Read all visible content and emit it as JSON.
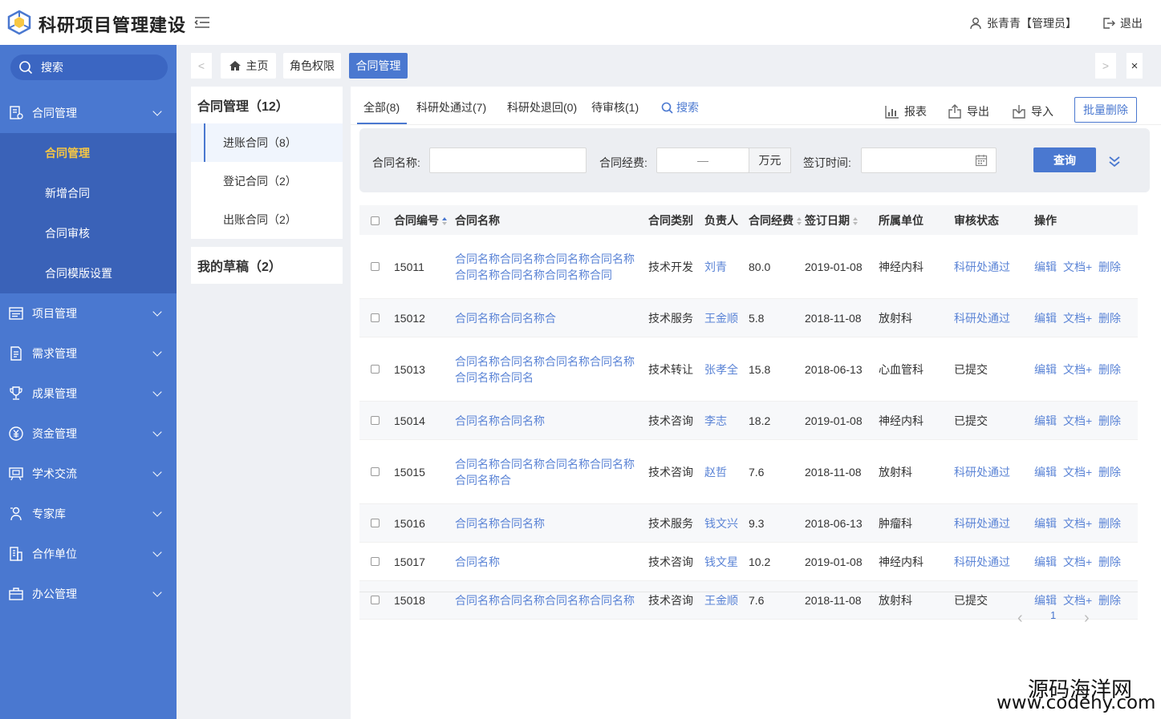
{
  "header": {
    "title": "科研项目管理建设",
    "user": "张青青【管理员】",
    "logout": "退出"
  },
  "sidebar": {
    "search_label": "搜索",
    "menus": [
      {
        "label": "合同管理",
        "icon": "contract-icon",
        "expanded": true
      },
      {
        "label": "项目管理",
        "icon": "project-icon"
      },
      {
        "label": "需求管理",
        "icon": "document-icon"
      },
      {
        "label": "成果管理",
        "icon": "trophy-icon"
      },
      {
        "label": "资金管理",
        "icon": "yuan-icon"
      },
      {
        "label": "学术交流",
        "icon": "presentation-icon"
      },
      {
        "label": "专家库",
        "icon": "expert-icon"
      },
      {
        "label": "合作单位",
        "icon": "building-icon"
      },
      {
        "label": "办公管理",
        "icon": "briefcase-icon"
      }
    ],
    "submenu": [
      {
        "label": "合同管理",
        "active": true
      },
      {
        "label": "新增合同"
      },
      {
        "label": "合同审核"
      },
      {
        "label": "合同模版设置"
      }
    ],
    "accent": "#4a78d0",
    "active_color": "#f7c744"
  },
  "tabs": {
    "prev": "<",
    "next": ">",
    "close": "×",
    "items": [
      {
        "label": "主页",
        "icon": "home-icon"
      },
      {
        "label": "角色权限"
      },
      {
        "label": "合同管理",
        "active": true
      }
    ]
  },
  "leftpanel": {
    "title": "合同管理（12）",
    "items": [
      "进账合同（8）",
      "登记合同（2）",
      "出账合同（2）"
    ],
    "drafts": "我的草稿（2）"
  },
  "filter_tabs": [
    "全部(8)",
    "科研处通过(7)",
    "科研处退回(0)",
    "待审核(1)"
  ],
  "search_link": "搜索",
  "tools": {
    "report": "报表",
    "export": "导出",
    "import": "导入",
    "batch_delete": "批量删除"
  },
  "filter": {
    "name_label": "合同名称:",
    "fund_label": "合同经费:",
    "fund_sep": "—",
    "fund_unit": "万元",
    "date_label": "签订时间:",
    "query": "查询"
  },
  "table": {
    "columns": [
      "合同编号",
      "合同名称",
      "合同类别",
      "负责人",
      "合同经费",
      "签订日期",
      "所属单位",
      "审核状态",
      "操作"
    ],
    "actions": [
      "编辑",
      "文档+",
      "删除"
    ],
    "rows": [
      {
        "id": "15011",
        "name": [
          "合同名称合同名称合同名称合同名称",
          "合同名称合同名称合同名称合同"
        ],
        "type": "技术开发",
        "owner": "刘青",
        "fund": "80.0",
        "date": "2019-01-08",
        "unit": "神经内科",
        "status": "科研处通过",
        "status_link": true
      },
      {
        "id": "15012",
        "name": [
          "合同名称合同名称合"
        ],
        "type": "技术服务",
        "owner": "王金顺",
        "fund": "5.8",
        "date": "2018-11-08",
        "unit": "放射科",
        "status": "科研处通过",
        "status_link": true
      },
      {
        "id": "15013",
        "name": [
          "合同名称合同名称合同名称合同名称",
          "合同名称合同名"
        ],
        "type": "技术转让",
        "owner": "张孝全",
        "fund": "15.8",
        "date": "2018-06-13",
        "unit": "心血管科",
        "status": "已提交",
        "status_link": false
      },
      {
        "id": "15014",
        "name": [
          "合同名称合同名称"
        ],
        "type": "技术咨询",
        "owner": "李志",
        "fund": "18.2",
        "date": "2019-01-08",
        "unit": "神经内科",
        "status": "已提交",
        "status_link": false
      },
      {
        "id": "15015",
        "name": [
          "合同名称合同名称合同名称合同名称",
          "合同名称合"
        ],
        "type": "技术咨询",
        "owner": "赵哲",
        "fund": "7.6",
        "date": "2018-11-08",
        "unit": "放射科",
        "status": "科研处通过",
        "status_link": true
      },
      {
        "id": "15016",
        "name": [
          "合同名称合同名称"
        ],
        "type": "技术服务",
        "owner": "钱文兴",
        "fund": "9.3",
        "date": "2018-06-13",
        "unit": "肿瘤科",
        "status": "科研处通过",
        "status_link": true
      },
      {
        "id": "15017",
        "name": [
          "合同名称"
        ],
        "type": "技术咨询",
        "owner": "钱文星",
        "fund": "10.2",
        "date": "2019-01-08",
        "unit": "神经内科",
        "status": "科研处通过",
        "status_link": true
      },
      {
        "id": "15018",
        "name": [
          "合同名称合同名称合同名称合同名称"
        ],
        "type": "技术咨询",
        "owner": "王金顺",
        "fund": "7.6",
        "date": "2018-11-08",
        "unit": "放射科",
        "status": "已提交",
        "status_link": false
      }
    ]
  },
  "pager": {
    "prev": "‹",
    "page": "1",
    "next": "›"
  },
  "watermark": {
    "line1": "源码海洋网",
    "line2": "www.codehy.com"
  }
}
